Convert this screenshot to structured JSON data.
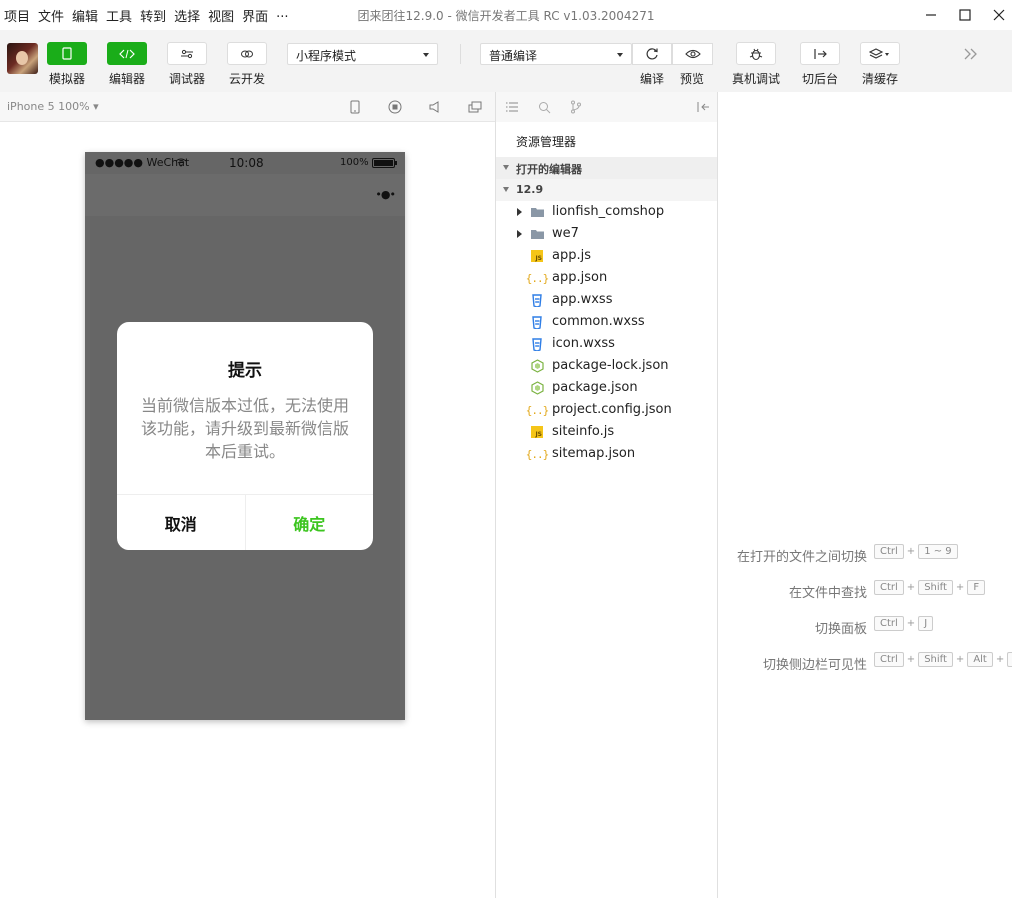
{
  "menu": [
    "项目",
    "文件",
    "编辑",
    "工具",
    "转到",
    "选择",
    "视图",
    "界面",
    "..."
  ],
  "window_title": "团来团往12.9.0 - 微信开发者工具 RC v1.03.2004271",
  "toolbar": {
    "simulator_label": "模拟器",
    "editor_label": "编辑器",
    "debugger_label": "调试器",
    "cloud_label": "云开发",
    "mode_select": "小程序模式",
    "compile_select": "普通编译",
    "compile_label": "编译",
    "preview_label": "预览",
    "device_debug_label": "真机调试",
    "background_label": "切后台",
    "clear_cache_label": "清缓存"
  },
  "simulator": {
    "device": "iPhone 5 100% ▾",
    "status_carrier": "●●●●● WeChat",
    "status_time": "10:08",
    "status_battery": "100%",
    "capsule": "•●•"
  },
  "dialog": {
    "title": "提示",
    "message": "当前微信版本过低，无法使用该功能，请升级到最新微信版本后重试。",
    "cancel": "取消",
    "confirm": "确定"
  },
  "explorer": {
    "title": "资源管理器",
    "open_editors": "打开的编辑器",
    "project": "12.9",
    "files": [
      {
        "name": "lionfish_comshop",
        "icon": "folder-icon"
      },
      {
        "name": "we7",
        "icon": "folder-icon"
      },
      {
        "name": "app.js",
        "icon": "js-file-icon"
      },
      {
        "name": "app.json",
        "icon": "json-file-icon"
      },
      {
        "name": "app.wxss",
        "icon": "wxss-file-icon"
      },
      {
        "name": "common.wxss",
        "icon": "wxss-file-icon"
      },
      {
        "name": "icon.wxss",
        "icon": "wxss-file-icon"
      },
      {
        "name": "package-lock.json",
        "icon": "node-json-icon"
      },
      {
        "name": "package.json",
        "icon": "node-json-icon"
      },
      {
        "name": "project.config.json",
        "icon": "json-file-icon"
      },
      {
        "name": "siteinfo.js",
        "icon": "js-file-icon"
      },
      {
        "name": "sitemap.json",
        "icon": "json-file-icon"
      }
    ]
  },
  "shortcuts": [
    {
      "label": "在打开的文件之间切换",
      "keys": [
        "Ctrl",
        "1 ~ 9"
      ]
    },
    {
      "label": "在文件中查找",
      "keys": [
        "Ctrl",
        "Shift",
        "F"
      ]
    },
    {
      "label": "切换面板",
      "keys": [
        "Ctrl",
        "J"
      ]
    },
    {
      "label": "切换侧边栏可见性",
      "keys": [
        "Ctrl",
        "Shift",
        "Alt",
        "B"
      ]
    }
  ],
  "colors": {
    "accent_green": "#1aad19",
    "confirm_green": "#3cc51f",
    "phone_mask": "#666666"
  }
}
